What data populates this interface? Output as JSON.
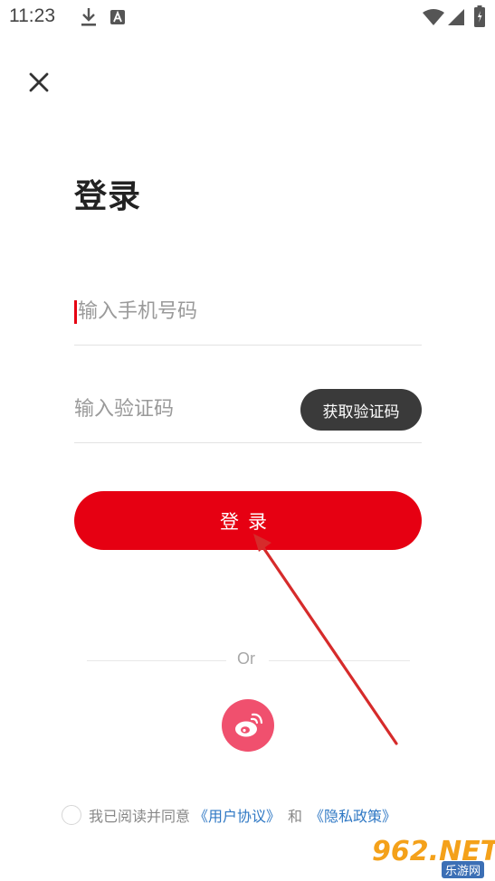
{
  "status_bar": {
    "time": "11:23",
    "left_icons": [
      "download-icon",
      "text-notification-icon"
    ],
    "right_icons": [
      "wifi-icon",
      "signal-icon",
      "battery-icon"
    ]
  },
  "header": {
    "close_icon": "close-icon"
  },
  "title": "登录",
  "form": {
    "phone_placeholder": "输入手机号码",
    "phone_value": "",
    "code_placeholder": "输入验证码",
    "code_value": "",
    "get_code_label": "获取验证码",
    "login_label": "登录"
  },
  "social": {
    "or_label": "Or",
    "weibo_icon": "weibo-icon"
  },
  "agreement": {
    "text": "我已阅读并同意",
    "user_agreement": "《用户协议》",
    "and": "和",
    "privacy_policy": "《隐私政策》",
    "checked": false
  },
  "watermark": {
    "main": "962.NET",
    "sub": "乐游网"
  },
  "colors": {
    "primary": "#e60012",
    "dark_button": "#3a3a3a",
    "weibo": "#f0506e",
    "link": "#2f78c4",
    "annotation_arrow": "#d62b2b"
  }
}
